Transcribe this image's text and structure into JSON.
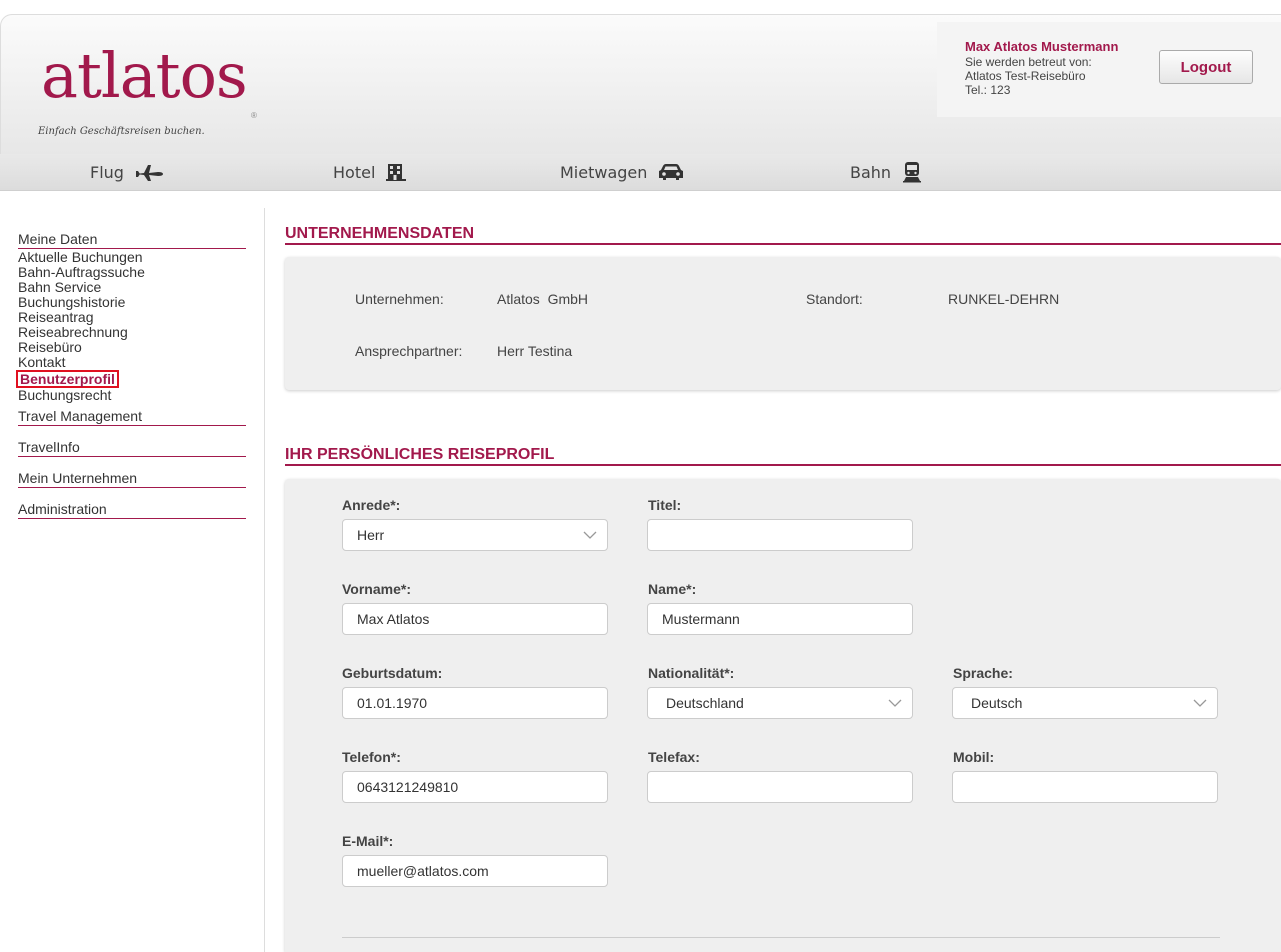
{
  "brand": {
    "logo": "atlatos",
    "reg": "®",
    "tagline": "Einfach Geschäftsreisen buchen."
  },
  "user": {
    "name": "Max Atlatos Mustermann",
    "line1": "Sie werden betreut von:",
    "line2": "Atlatos Test-Reisebüro",
    "line3": "Tel.: 123",
    "logout": "Logout"
  },
  "nav": [
    {
      "label": "Flug",
      "icon": "plane-icon"
    },
    {
      "label": "Hotel",
      "icon": "building-icon"
    },
    {
      "label": "Mietwagen",
      "icon": "car-icon"
    },
    {
      "label": "Bahn",
      "icon": "train-icon"
    }
  ],
  "sidebar": {
    "meine_daten": "Meine Daten",
    "items": [
      "Aktuelle Buchungen",
      "Bahn-Auftragssuche",
      "Bahn Service",
      "Buchungshistorie",
      "Reiseantrag",
      "Reiseabrechnung",
      "Reisebüro",
      "Kontakt",
      "Benutzerprofil",
      "Buchungsrecht"
    ],
    "travel_management": "Travel Management",
    "travelinfo": "TravelInfo",
    "mein_unternehmen": "Mein Unternehmen",
    "administration": "Administration"
  },
  "company": {
    "title": "UNTERNEHMENSDATEN",
    "unternehmen_label": "Unternehmen:",
    "unternehmen_value": "Atlatos  GmbH",
    "standort_label": "Standort:",
    "standort_value": "RUNKEL-DEHRN",
    "ansprech_label": "Ansprechpartner:",
    "ansprech_value": "Herr Testina"
  },
  "profile": {
    "title": "IHR PERSÖNLICHES REISEPROFIL",
    "anrede": {
      "label": "Anrede*:",
      "value": "Herr"
    },
    "titel": {
      "label": "Titel:",
      "value": ""
    },
    "vorname": {
      "label": "Vorname*:",
      "value": "Max Atlatos"
    },
    "name": {
      "label": "Name*:",
      "value": "Mustermann"
    },
    "geburtsdatum": {
      "label": "Geburtsdatum:",
      "value": "01.01.1970"
    },
    "nationalitaet": {
      "label": "Nationalität*:",
      "value": "Deutschland"
    },
    "sprache": {
      "label": "Sprache:",
      "value": "Deutsch"
    },
    "telefon": {
      "label": "Telefon*:",
      "value": "0643121249810"
    },
    "telefax": {
      "label": "Telefax:",
      "value": ""
    },
    "mobil": {
      "label": "Mobil:",
      "value": ""
    },
    "email": {
      "label": "E-Mail*:",
      "value": "mueller@atlatos.com"
    }
  },
  "colors": {
    "accent": "#a2194c",
    "highlight": "#e01020",
    "panel": "#efefef"
  }
}
